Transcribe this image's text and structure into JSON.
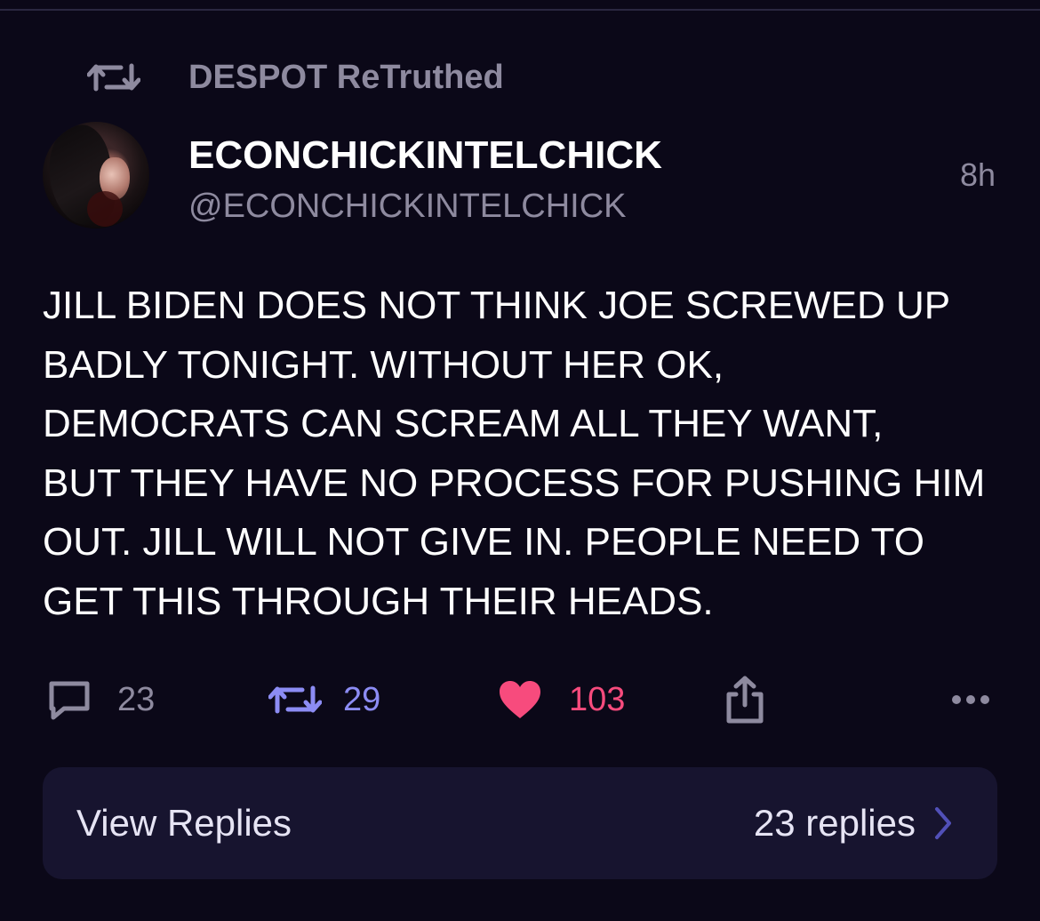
{
  "retruth": {
    "icon": "retruth-icon",
    "label": "DESPOT ReTruthed"
  },
  "author": {
    "avatar": "avatar",
    "display_name": "ECONCHICKINTELCHICK",
    "handle": "@ECONCHICKINTELCHICK",
    "time": "8h"
  },
  "post": {
    "lines": [
      "JILL BIDEN DOES NOT THINK JOE SCREWED UP",
      "BADLY TONIGHT. WITHOUT HER OK,",
      "DEMOCRATS CAN SCREAM ALL THEY WANT,",
      "BUT THEY HAVE NO PROCESS FOR PUSHING HIM",
      "OUT. JILL WILL NOT GIVE IN. PEOPLE NEED TO",
      "GET THIS THROUGH THEIR HEADS."
    ]
  },
  "actions": {
    "reply": {
      "icon": "comment-icon",
      "count": "23"
    },
    "retruth": {
      "icon": "retruth-icon",
      "count": "29"
    },
    "like": {
      "icon": "heart-icon",
      "count": "103"
    },
    "share": {
      "icon": "share-icon"
    },
    "more": {
      "icon": "more-icon"
    }
  },
  "replies": {
    "label": "View Replies",
    "count_text": "23 replies",
    "icon": "chevron-right-icon"
  },
  "colors": {
    "background": "#0b0818",
    "muted": "#8e8a9f",
    "accent_blue": "#8c8cf4",
    "like_pink": "#f74b7d",
    "replies_bar": "#17142f"
  }
}
